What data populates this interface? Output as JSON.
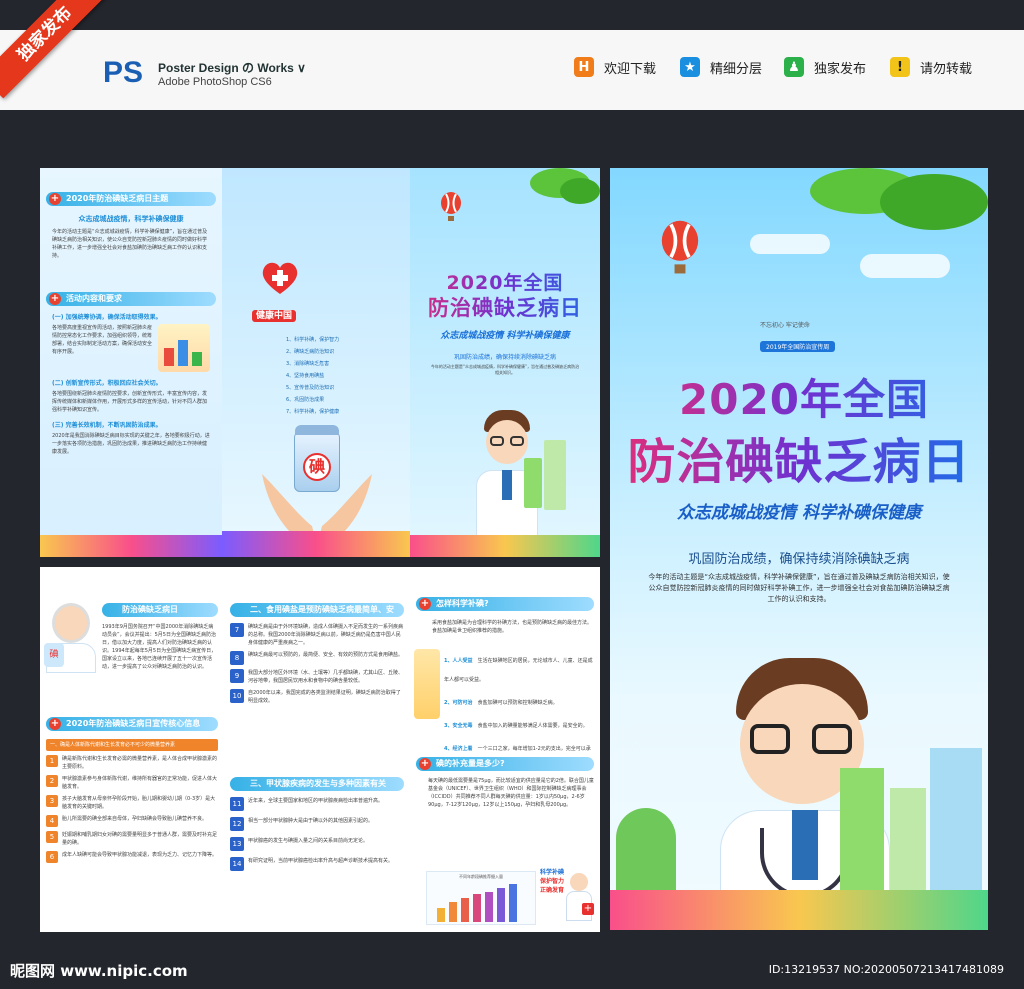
{
  "ribbon": "独家发布",
  "header": {
    "logo": "PS",
    "title": "Poster Design の Works ∨",
    "subtitle": "Adobe PhotoShop CS6",
    "items": [
      {
        "label": "欢迎下载",
        "icon": "h-icon",
        "glyph": "H",
        "color": "#f07d1a"
      },
      {
        "label": "精细分层",
        "icon": "star-icon",
        "glyph": "★",
        "color": "#1a8fe0"
      },
      {
        "label": "独家发布",
        "icon": "user-icon",
        "glyph": "♟",
        "color": "#2bb04a"
      },
      {
        "label": "请勿转载",
        "icon": "warning-icon",
        "glyph": "!",
        "color": "#f2c318"
      }
    ]
  },
  "p1": {
    "h1": "2020年防治碘缺乏病日主题",
    "theme": "众志成城战疫情，科学补碘保健康",
    "para1": "今年的活动主题是“众志成城战疫情，科学补碘保健康”，旨在通过普及碘缺乏病防治相关知识，使公众自觉防控新冠肺炎疫情的同时做好科学补碘工作，进一步增强全社会对食盐加碘防治碘缺乏病工作的认识和支持。",
    "h2": "活动内容和要求",
    "s1": "(一) 加强统筹协调，确保活动取得效果。",
    "para2": "各地要高度重视宣传周活动，按照新冠肺炎疫情防控常态化工作要求，加强组织领导，统筹部署，结合实际制定活动方案，确保活动安全有序开展。",
    "s2": "(二) 创新宣传形式，积极回应社会关切。",
    "para3": "各地要围绕新冠肺炎疫情防控要求，创新宣传形式，丰富宣传内容，发挥传统媒体和新媒体作用，开展形式多样的宣传活动，针对不同人群加强科学补碘知识宣传。",
    "s3": "(三) 完善长效机制，不断巩固防治成果。",
    "para4": "2020年是我国消除碘缺乏病目标实现的关键之年，各地要积极行动，进一步落实各项防治措施，巩固防治成果，推进碘缺乏病防治工作持续健康发展。"
  },
  "p2": {
    "badge": "健康中国",
    "list": [
      "1、科学补碘，保护智力",
      "2、碘缺乏病防治知识",
      "3、消除碘缺乏危害",
      "4、坚持食用碘盐",
      "5、宣传普及防治知识",
      "6、巩固防治成果",
      "7、科学补碘，保护健康"
    ],
    "salt": "碘"
  },
  "p3": {
    "title1": "2020年全国",
    "title2": "防治碘缺乏病日",
    "slogan": "众志成城战疫情 科学补碘保健康",
    "line": "巩固防治成绩，确保持续消除碘缺乏病",
    "para": "今年的活动主题是“众志成城战疫情，科学补碘保健康”，旨在通过普及碘缺乏病防治相关知识。"
  },
  "p4": {
    "small1": "不忘初心 牢记使命",
    "small2": "2019年全国防治宣传周",
    "title1": "2020年全国",
    "title2": "防治碘缺乏病日",
    "slogan": "众志成城战疫情 科学补碘保健康",
    "line": "巩固防治成绩，确保持续消除碘缺乏病",
    "para": "今年的活动主题是“众志成城战疫情，科学补碘保健康”，旨在通过普及碘缺乏病防治相关知识，使公众自觉防控新冠肺炎疫情的同时做好科学补碘工作，进一步增强全社会对食盐加碘防治碘缺乏病工作的认识和支持。"
  },
  "p5": {
    "h1": "防治碘缺乏病日",
    "para1": "1993年9月国务院召开“中国2000年消除碘缺乏病动员会”，会议并提出：5月5日为全国碘缺乏病防治日，借以加大力度，提高人们对防治碘缺乏病的认识。1994年起每年5月5日为全国碘缺乏病宣传日，国家设立以来，各地已连续开展了五十一次宣传活动，进一步提高了公众对碘缺乏病防治的认识。",
    "h2": "2020年防治碘缺乏病日宣传核心信息",
    "bar": "一、确是人体新陈代谢和生长发育必不可少的微量营养素",
    "items": [
      {
        "n": "1",
        "t": "碘是新陈代谢和生长发育必需的微量营养素，是人体合成甲状腺激素的主要原料。"
      },
      {
        "n": "2",
        "t": "甲状腺激素参与身体新陈代谢，维持所有器官的正常功能，促进人体大脑发育。"
      },
      {
        "n": "3",
        "t": "孩子大脑发育从母亲怀孕阶段开始，胎儿期和婴幼儿期（0-3岁）是大脑发育的关键时期。"
      },
      {
        "n": "4",
        "t": "胎儿所需要的碘全部来自母体，孕妇缺碘会导致胎儿碘营养不良。"
      },
      {
        "n": "5",
        "t": "妊娠期和哺乳期妇女对碘的需要量明显多于普通人群，需要及时补充足量的碘。"
      },
      {
        "n": "6",
        "t": "成年人缺碘可能会导致甲状腺功能减退，表现为乏力、记忆力下降等。"
      }
    ]
  },
  "p6": {
    "h1": "二、食用碘盐是预防碘缺乏病最简单、安全、有效的方式",
    "items": [
      {
        "n": "7",
        "t": "碘缺乏病是由于外环境缺碘，造成人体碘摄入不足而发生的一系列疾病的总称。我国2000年消除碘缺乏病以前，碘缺乏病仍是危害中国人民身体健康的严重疾病之一。"
      },
      {
        "n": "8",
        "t": "碘缺乏病最可以预防的，最简便、安全、有效的预防方式是食用碘盐。"
      },
      {
        "n": "9",
        "t": "我国大部分地区外环境（水、土壤等）几乎都缺碘，尤其山区、丘陵、河谷地带，我国居民饮用水和食物中的碘含量较低。"
      },
      {
        "n": "10",
        "t": "自2000年以来，我国完成的各类监测结果证明，碘缺乏病防治取得了明显成效。"
      }
    ],
    "h2": "三、甲状腺疾病的发生与多种因素有关",
    "items2": [
      {
        "n": "11",
        "t": "近年来，全球主要国家和地区的甲状腺疾病检出率普遍升高。"
      },
      {
        "n": "12",
        "t": "相当一部分甲状腺肿大是由于碘以外的其他因素引起的。"
      },
      {
        "n": "13",
        "t": "甲状腺癌的发生与碘摄入量之间的关系目前尚无定论。"
      },
      {
        "n": "14",
        "t": "有研究证明，当前甲状腺癌检出率升高与超声诊断技术提高有关。"
      }
    ]
  },
  "p7": {
    "h1": "怎样科学补碘?",
    "para1": "采用食盐加碘是为合理科学的补碘方法，也是预防碘缺乏病的最佳方法。食盐加碘是世卫组织推荐的措施。",
    "tips": [
      {
        "title": "1、人人受益",
        "t": "生活在缺碘地区的居民，无论城市人、儿童、还是成年人都可以受益。"
      },
      {
        "title": "2、可防可治",
        "t": "食盐加碘可以预防和控制碘缺乏病。"
      },
      {
        "title": "3、安全无毒",
        "t": "食盐中加入的碘量能够满足人体需要，是安全的。"
      },
      {
        "title": "4、经济上着",
        "t": "一个三口之家，每年增加1-2元的支出，完全可以承受。"
      }
    ],
    "h2": "碘的补充量是多少?",
    "para2": "每天碘的最低需要量是75μg，而比较适宜的供应量是它的2倍。联合国儿童基金会（UNICEF）、世界卫生组织（WHO）和国际控制碘缺乏病理事会（ICCIDD）共同推荐不同人群每天碘的供应量：1岁以内50μg，2-6岁90μg，7-12岁120μg，12岁以上150μg，孕妇和乳母200μg。",
    "chart_title": "不同年龄段碘推荐摄入量",
    "poster_l1": "科学补碘",
    "poster_l2": "保护智力",
    "poster_l3": "正确发育"
  },
  "footer": {
    "logo": "昵图网 www.nipic.com",
    "id": "ID:13219537 NO:20200507213417481089"
  },
  "colors": {
    "accent_blue": "#1d74d9",
    "accent_red": "#e8412f",
    "magenta": "#e22e7a"
  }
}
